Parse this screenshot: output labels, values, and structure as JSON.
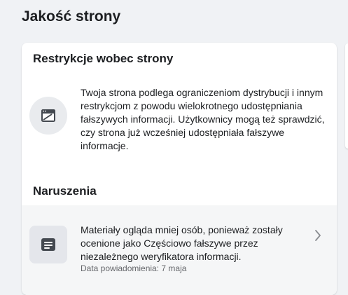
{
  "page": {
    "title": "Jakość strony"
  },
  "restrictions": {
    "title": "Restrykcje wobec strony",
    "icon": "restricted-window-icon",
    "text": "Twoja strona podlega ograniczeniom dystrybucji i innym restrykcjom z powodu wielokrotnego udostępniania fałszywych informacji. Użytkownicy mogą też sprawdzić, czy strona już wcześniej udostępniała fałszywe informacje."
  },
  "violations": {
    "title": "Naruszenia",
    "items": [
      {
        "icon": "document-icon",
        "text": "Materiały ogląda mniej osób, ponieważ zostały ocenione jako Częściowo fałszywe przez niezależnego weryfikatora informacji.",
        "date": "Data powiadomienia: 7 maja"
      }
    ]
  },
  "colors": {
    "background": "#f0f2f5",
    "card": "#ffffff",
    "text_primary": "#1c1e21",
    "text_secondary": "#65676b",
    "icon": "#444950"
  }
}
